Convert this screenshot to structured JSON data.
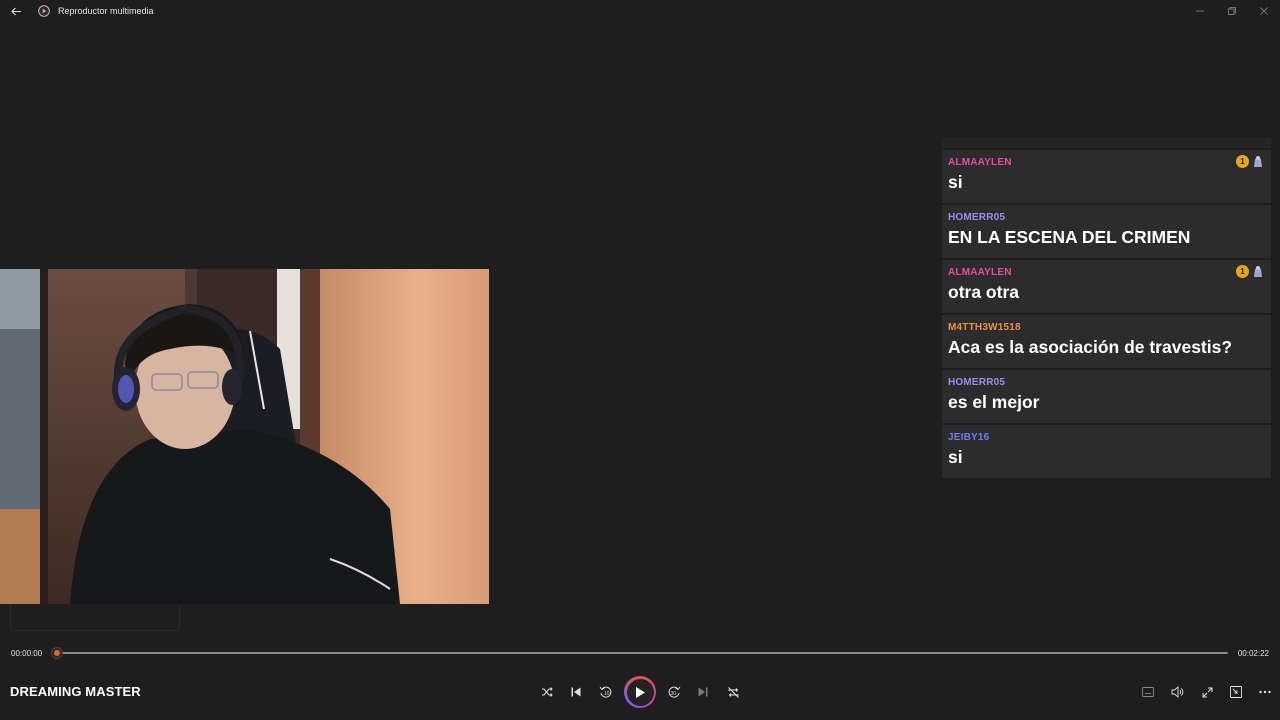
{
  "window": {
    "title": "Reproductor multimedia"
  },
  "chat": {
    "messages": [
      {
        "user": "ALMAAYLEN",
        "text": "si",
        "color": "#e64aa6",
        "badge_count": "1"
      },
      {
        "user": "HOMERR05",
        "text": "EN LA ESCENA DEL CRIMEN",
        "color": "#9b8cf0"
      },
      {
        "user": "ALMAAYLEN",
        "text": "otra otra",
        "color": "#e64aa6",
        "badge_count": "1"
      },
      {
        "user": "M4TTH3W1518",
        "text": "Aca es la asociación de travestis?",
        "color": "#e8903a"
      },
      {
        "user": "HOMERR05",
        "text": "es el mejor",
        "color": "#9b8cf0"
      },
      {
        "user": "JEIBY16",
        "text": "si",
        "color": "#6f7cf0"
      }
    ]
  },
  "player": {
    "current_time": "00:00:00",
    "total_time": "00:02:22",
    "progress": 0.0,
    "track_title": "DREAMING MASTER",
    "accent": "#e0652c"
  }
}
